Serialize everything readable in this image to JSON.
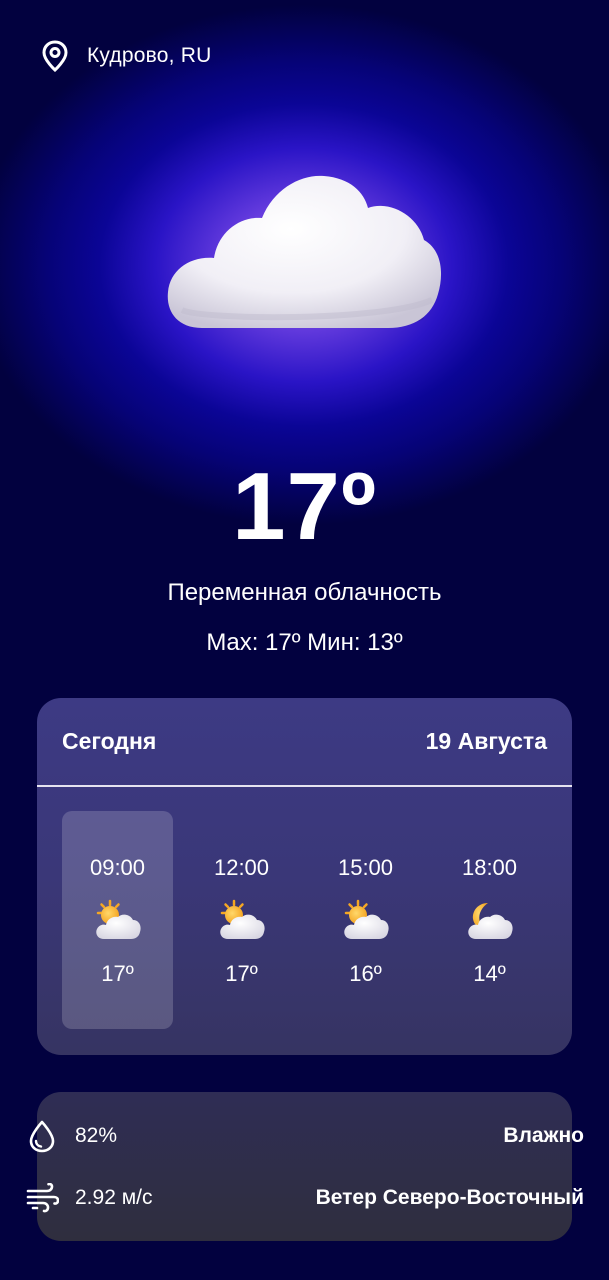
{
  "location": {
    "text": "Кудрово, RU",
    "icon": "location-pin-icon"
  },
  "current": {
    "temperature": "17º",
    "condition": "Переменная облачность",
    "max_min": "Max: 17º Мин: 13º",
    "icon": "cloud-icon"
  },
  "forecast": {
    "title": "Сегодня",
    "date": "19 Августа",
    "hours": [
      {
        "time": "09:00",
        "temp": "17º",
        "icon": "sun-behind-cloud-icon",
        "selected": true
      },
      {
        "time": "12:00",
        "temp": "17º",
        "icon": "sun-behind-cloud-icon",
        "selected": false
      },
      {
        "time": "15:00",
        "temp": "16º",
        "icon": "sun-behind-cloud-icon",
        "selected": false
      },
      {
        "time": "18:00",
        "temp": "14º",
        "icon": "moon-behind-cloud-icon",
        "selected": false
      }
    ]
  },
  "details": {
    "humidity": {
      "value": "82%",
      "label": "Влажно",
      "icon": "water-drop-icon"
    },
    "wind": {
      "value": "2.92 м/с",
      "label": "Ветер Северо-Восточный",
      "icon": "wind-icon"
    }
  },
  "colors": {
    "card": "#3d3a84",
    "accent_glow": "#b07ae8",
    "background": "#060377"
  }
}
